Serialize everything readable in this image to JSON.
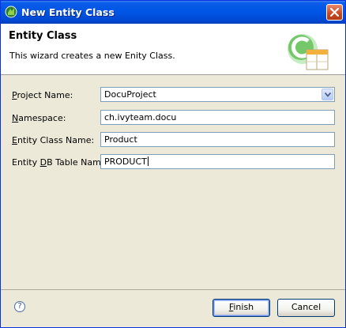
{
  "window": {
    "title": "New Entity Class"
  },
  "header": {
    "title": "Entity Class",
    "description": "This wizard creates a new Enity Class."
  },
  "form": {
    "project_name": {
      "label_ul": "P",
      "label_rest": "roject Name:",
      "value": "DocuProject"
    },
    "namespace": {
      "label_ul": "N",
      "label_rest": "amespace:",
      "value": "ch.ivyteam.docu"
    },
    "entity_class_name": {
      "label_ul": "E",
      "label_rest": "ntity Class Name:",
      "value": "Product"
    },
    "entity_db_table_name": {
      "label_pre": "Entity ",
      "label_ul": "D",
      "label_rest": "B Table Name:",
      "value": "PRODUCT"
    }
  },
  "footer": {
    "help_glyph": "?",
    "finish_ul": "F",
    "finish_rest": "inish",
    "cancel_label": "Cancel"
  }
}
